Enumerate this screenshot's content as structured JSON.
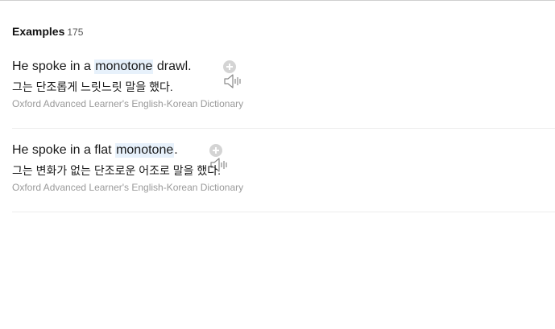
{
  "heading": {
    "title": "Examples",
    "count": "175"
  },
  "examples": [
    {
      "before": "He spoke in a ",
      "keyword": "monotone",
      "after": " drawl.",
      "translation": "그는 단조롭게 느릿느릿 말을 했다.",
      "source": "Oxford Advanced Learner's English-Korean Dictionary"
    },
    {
      "before": "He spoke in a flat ",
      "keyword": "monotone",
      "after": ".",
      "translation": "그는 변화가 없는 단조로운 어조로 말을 했다.",
      "source": "Oxford Advanced Learner's English-Korean Dictionary"
    }
  ],
  "icons": {
    "speaker": "speaker-icon",
    "add": "plus-circle-icon"
  },
  "colors": {
    "highlight": "#e7f1fb",
    "source_text": "#9a9a9a",
    "icon_gray": "#d4d4d4"
  }
}
